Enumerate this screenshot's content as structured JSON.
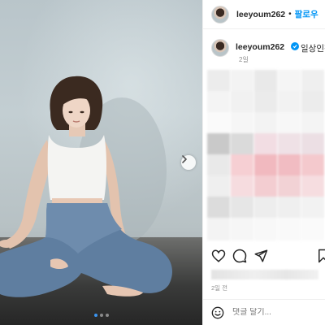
{
  "post": {
    "username": "leeyoum262",
    "header_separator": "•",
    "follow_label": "팔로우",
    "caption_text": "일상인척",
    "caption_time": "2일",
    "date": "2일 전",
    "comment_placeholder": "댓글 달기...",
    "carousel": {
      "total_slides": 3,
      "active_index": 0
    }
  },
  "icons": {
    "like": "heart-icon",
    "comment": "comment-icon",
    "share": "send-icon",
    "save": "bookmark-icon",
    "emoji": "emoji-icon",
    "next": "chevron-right-icon",
    "verified": "verified-badge-icon"
  },
  "colors": {
    "accent": "#0095f6",
    "text": "#262626",
    "muted": "#8e8e8e",
    "dot_active": "#3b95f1"
  }
}
